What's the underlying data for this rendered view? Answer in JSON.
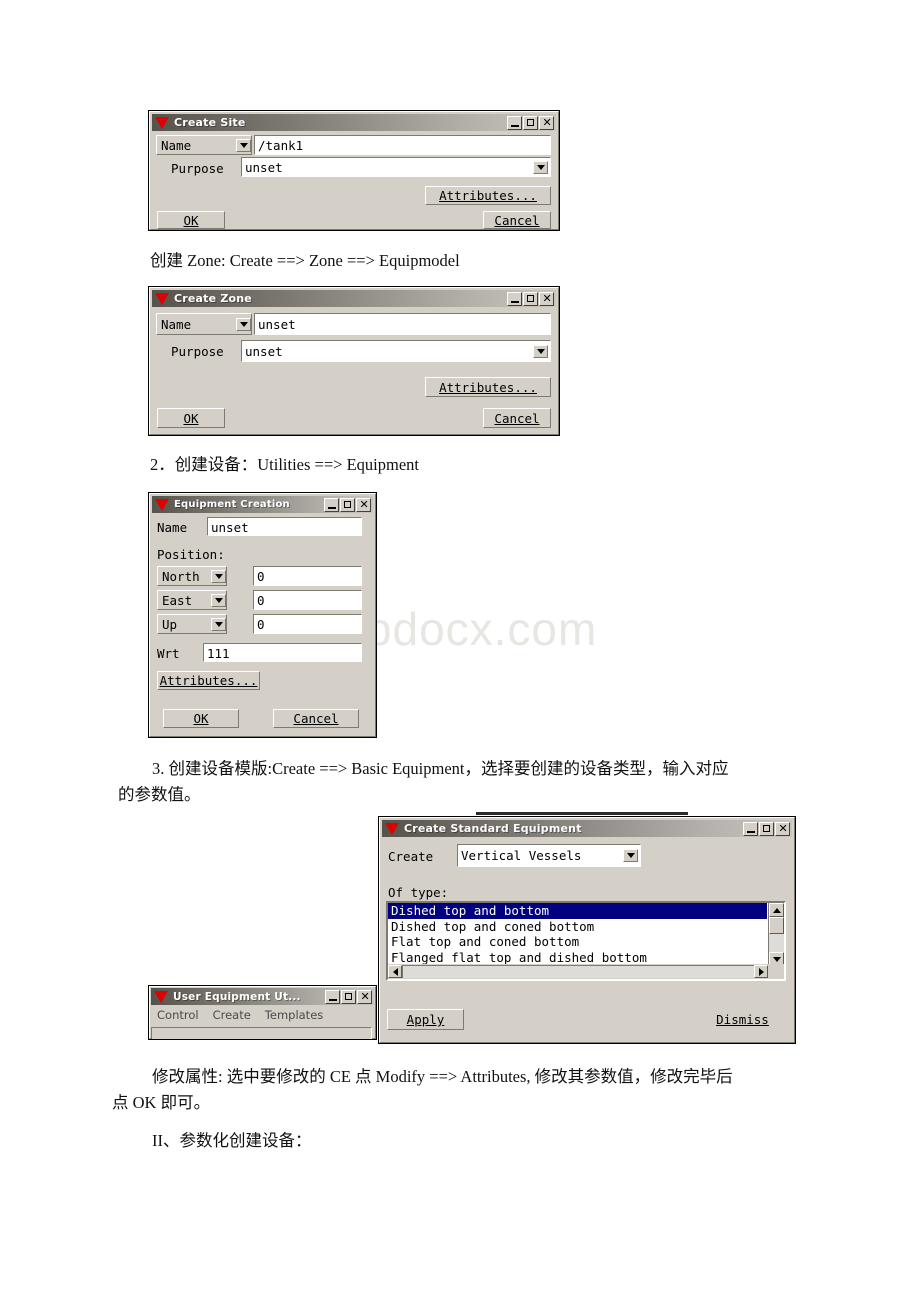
{
  "document": {
    "watermark": "www.bdocx.com",
    "paragraphs": {
      "p_create_zone": "创建 Zone: Create ==> Zone ==> Equipmodel",
      "p_create_equipment": "2．创建设备：Utilities ==> Equipment",
      "p_create_template_l1": "3. 创建设备模版:Create ==> Basic Equipment，选择要创建的设备类型，输入对应",
      "p_create_template_l2": "的参数值。",
      "p_modify_attr_l1": "修改属性: 选中要修改的 CE 点 Modify ==> Attributes, 修改其参数值，修改完毕后",
      "p_modify_attr_l2": "点 OK 即可。",
      "p_section_ii": "II、参数化创建设备："
    }
  },
  "dialogs": {
    "create_site": {
      "title": "Create Site",
      "titlebar_icon": "red-triangle-icon",
      "window_buttons": [
        "minimize",
        "maximize",
        "close"
      ],
      "name_option_label": "Name",
      "name_value": "/tank1",
      "purpose_label": "Purpose",
      "purpose_value": "unset",
      "attributes_label": "Attributes...",
      "ok_label": "OK",
      "cancel_label": "Cancel"
    },
    "create_zone": {
      "title": "Create Zone",
      "titlebar_icon": "red-triangle-icon",
      "window_buttons": [
        "minimize",
        "maximize",
        "close"
      ],
      "name_option_label": "Name",
      "name_value": "unset",
      "purpose_label": "Purpose",
      "purpose_value": "unset",
      "attributes_label": "Attributes...",
      "ok_label": "OK",
      "cancel_label": "Cancel"
    },
    "equipment_creation": {
      "title": "Equipment Creation",
      "titlebar_icon": "red-triangle-icon",
      "window_buttons": [
        "minimize",
        "maximize",
        "close"
      ],
      "name_label": "Name",
      "name_value": "unset",
      "position_label": "Position:",
      "position_rows": [
        {
          "direction": "North",
          "value": "0"
        },
        {
          "direction": "East",
          "value": "0"
        },
        {
          "direction": "Up",
          "value": "0"
        }
      ],
      "wrt_label": "Wrt",
      "wrt_value": "111",
      "attributes_label": "Attributes...",
      "ok_label": "OK",
      "cancel_label": "Cancel"
    },
    "create_standard_equipment": {
      "title": "Create Standard Equipment",
      "titlebar_icon": "red-triangle-icon",
      "window_buttons": [
        "minimize",
        "maximize",
        "close"
      ],
      "create_label": "Create",
      "create_value": "Vertical Vessels",
      "of_type_label": "Of type:",
      "type_items": [
        "Dished top and bottom",
        "Dished top and coned bottom",
        "Flat top and coned bottom",
        "Flanged flat top and dished bottom"
      ],
      "selected_type_index": 0,
      "apply_label": "Apply",
      "dismiss_label": "Dismiss"
    },
    "user_equipment_utilities": {
      "title": "User Equipment Ut...",
      "titlebar_icon": "red-triangle-icon",
      "window_buttons": [
        "minimize",
        "maximize",
        "close"
      ],
      "menu_items": [
        "Control",
        "Create",
        "Templates"
      ]
    }
  },
  "colors": {
    "face": "#d4d0c8",
    "selection": "#000080",
    "accent_triangle": "#e00000",
    "watermark": "#e8e6e2"
  }
}
